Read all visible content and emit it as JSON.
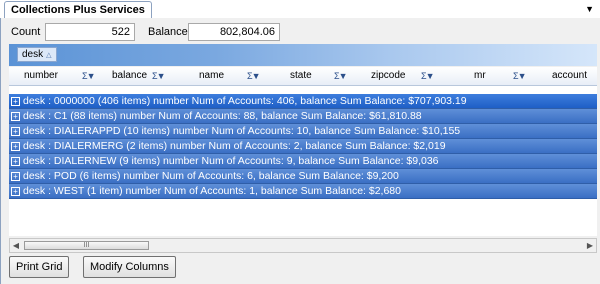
{
  "tab": {
    "title": "Collections Plus Services"
  },
  "summary": {
    "count_label": "Count",
    "count_value": "522",
    "balance_label": "Balance",
    "balance_value": "802,804.06"
  },
  "group_by": {
    "label": "desk"
  },
  "columns": [
    "number",
    "balance",
    "name",
    "state",
    "zipcode",
    "mr",
    "account"
  ],
  "rows": [
    "desk : 0000000 (406 items) number Num of Accounts: 406, balance Sum Balance:  $707,903.19",
    "desk : C1 (88 items) number Num of Accounts: 88, balance Sum Balance:  $61,810.88",
    "desk : DIALERAPPD (10 items) number Num of Accounts: 10, balance Sum Balance:  $10,155",
    "desk : DIALERMERG (2 items) number Num of Accounts: 2, balance Sum Balance:  $2,019",
    "desk : DIALERNEW (9 items) number Num of Accounts: 9, balance Sum Balance:  $9,036",
    "desk : POD (6 items) number Num of Accounts: 6, balance Sum Balance:  $9,200",
    "desk : WEST (1 item) number Num of Accounts: 1, balance Sum Balance:  $2,680"
  ],
  "buttons": {
    "print": "Print Grid",
    "modify": "Modify Columns"
  },
  "icons": {
    "expand": "plus-box-icon",
    "filter_sort": "sort-filter-icon",
    "tab_menu": "dropdown-arrow-icon"
  },
  "colors": {
    "row_fill": "#3a6fc4",
    "group_band": "#5b93d6"
  }
}
